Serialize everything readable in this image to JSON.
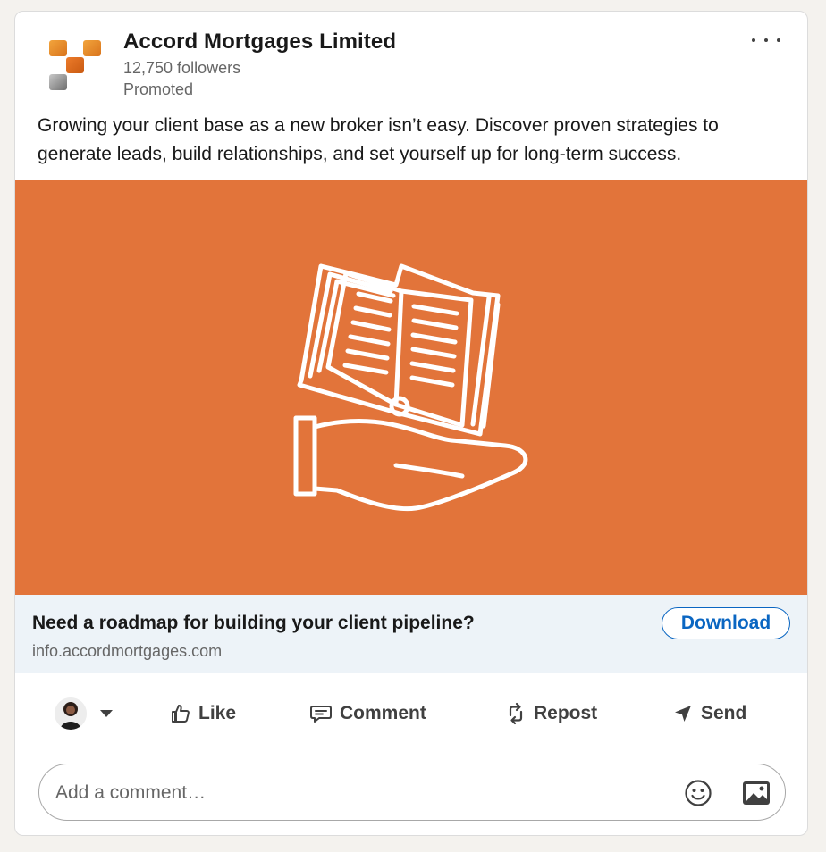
{
  "post": {
    "company_name": "Accord Mortgages Limited",
    "followers": "12,750 followers",
    "promoted_label": "Promoted",
    "body_text": "Growing your client base as a new broker isn’t easy. Discover proven strategies to generate leads, build relationships, and set yourself up for long-term success.",
    "hero_icon": "open-book-on-hand-icon",
    "hero_color": "#e2743a"
  },
  "cta": {
    "headline": "Need a roadmap for building your client pipeline?",
    "domain": "info.accordmortgages.com",
    "button_label": "Download"
  },
  "actions": {
    "like": "Like",
    "comment": "Comment",
    "repost": "Repost",
    "send": "Send"
  },
  "comment_box": {
    "placeholder": "Add a comment…"
  },
  "colors": {
    "brand_orange": "#e2743a",
    "link_blue": "#0a66c2",
    "cta_background": "#edf3f8"
  }
}
